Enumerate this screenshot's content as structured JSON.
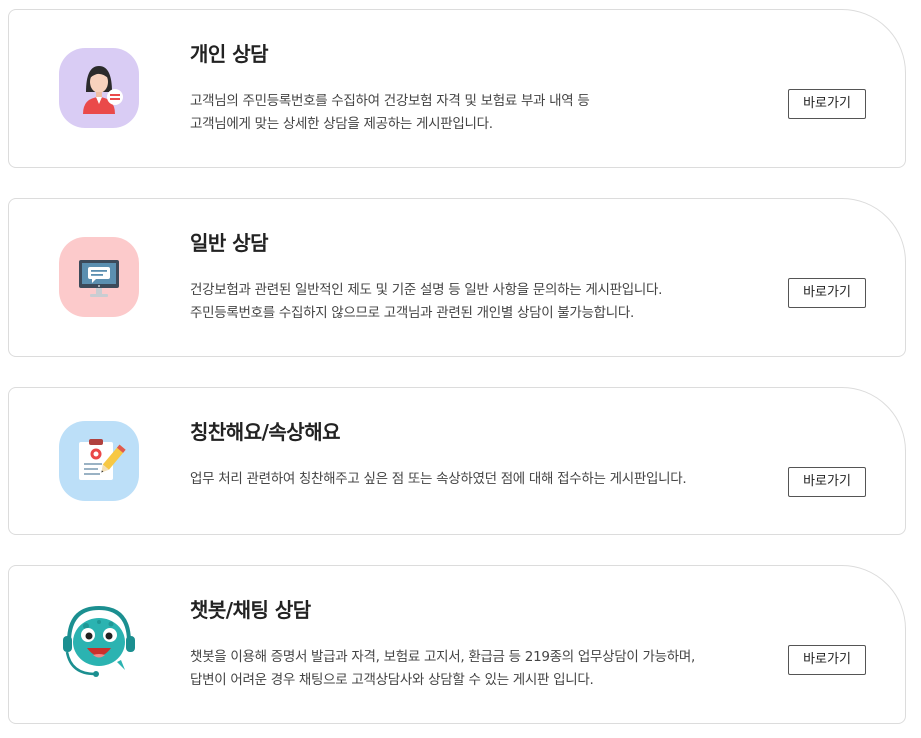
{
  "cards": [
    {
      "title": "개인 상담",
      "lines": [
        "고객님의 주민등록번호를 수집하여 건강보험 자격 및 보험료 부과 내역 등",
        "고객님에게 맞는 상세한 상담을 제공하는 게시판입니다."
      ],
      "button": "바로가기",
      "icon": "counselor-woman-icon",
      "icon_bg": "#d9ccf4"
    },
    {
      "title": "일반 상담",
      "lines": [
        "건강보험과 관련된 일반적인 제도 및 기준 설명 등 일반 사항을 문의하는 게시판입니다.",
        "주민등록번호를 수집하지 않으므로 고객님과 관련된 개인별 상담이 불가능합니다."
      ],
      "button": "바로가기",
      "icon": "monitor-chat-icon",
      "icon_bg": "#fccacb"
    },
    {
      "title": "칭찬해요/속상해요",
      "lines": [
        "업무 처리 관련하여 칭찬해주고 싶은 점 또는 속상하였던 점에 대해 접수하는 게시판입니다."
      ],
      "button": "바로가기",
      "icon": "clipboard-pencil-icon",
      "icon_bg": "#bcdff8"
    },
    {
      "title": "챗봇/채팅 상담",
      "lines": [
        "챗봇을 이용해 증명서 발급과 자격, 보험료 고지서, 환급금 등 219종의 업무상담이 가능하며,",
        "답변이 어려운 경우 채팅으로 고객상담사와 상담할 수 있는 게시판 입니다."
      ],
      "button": "바로가기",
      "icon": "chatbot-mascot-icon",
      "icon_bg": "#ffffff"
    }
  ]
}
